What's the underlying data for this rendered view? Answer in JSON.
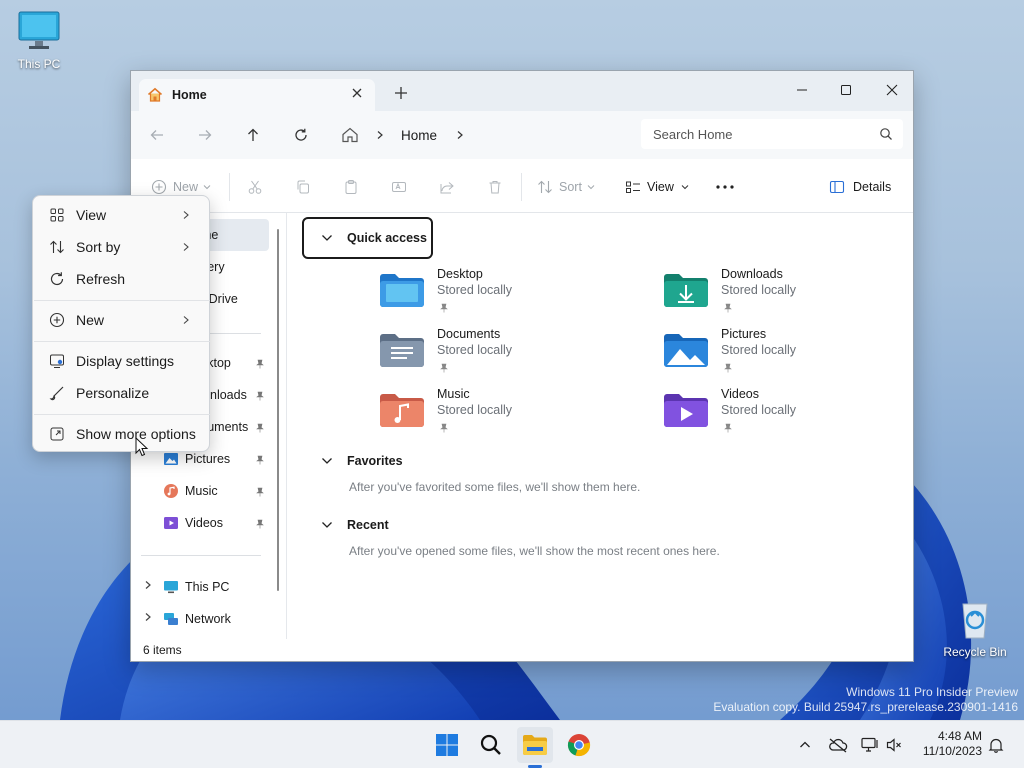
{
  "desktop": {
    "this_pc_label": "This PC",
    "recycle_bin_label": "Recycle Bin",
    "watermark_line1": "Windows 11 Pro Insider Preview",
    "watermark_line2": "Evaluation copy. Build 25947.rs_prerelease.230901-1416"
  },
  "window": {
    "tab_title": "Home",
    "breadcrumb": "Home",
    "search_placeholder": "Search Home",
    "status": "6 items"
  },
  "toolbar": {
    "new_label": "New",
    "sort_label": "Sort",
    "view_label": "View",
    "details_label": "Details"
  },
  "sidebar": {
    "items": [
      {
        "label": "Home"
      },
      {
        "label": "Gallery"
      },
      {
        "label": "OneDrive"
      },
      {
        "label": "Desktop"
      },
      {
        "label": "Downloads"
      },
      {
        "label": "Documents"
      },
      {
        "label": "Pictures"
      },
      {
        "label": "Music"
      },
      {
        "label": "Videos"
      },
      {
        "label": "This PC"
      },
      {
        "label": "Network"
      }
    ]
  },
  "content": {
    "quick_access": "Quick access",
    "favorites": "Favorites",
    "favorites_msg": "After you've favorited some files, we'll show them here.",
    "recent": "Recent",
    "recent_msg": "After you've opened some files, we'll show the most recent ones here.",
    "folders": [
      {
        "name": "Desktop",
        "sub": "Stored locally",
        "icon": "desktop-folder-icon"
      },
      {
        "name": "Downloads",
        "sub": "Stored locally",
        "icon": "downloads-folder-icon"
      },
      {
        "name": "Documents",
        "sub": "Stored locally",
        "icon": "documents-folder-icon"
      },
      {
        "name": "Pictures",
        "sub": "Stored locally",
        "icon": "pictures-folder-icon"
      },
      {
        "name": "Music",
        "sub": "Stored locally",
        "icon": "music-folder-icon"
      },
      {
        "name": "Videos",
        "sub": "Stored locally",
        "icon": "videos-folder-icon"
      }
    ]
  },
  "context_menu": {
    "items": [
      {
        "label": "View"
      },
      {
        "label": "Sort by"
      },
      {
        "label": "Refresh"
      },
      {
        "label": "New"
      },
      {
        "label": "Display settings"
      },
      {
        "label": "Personalize"
      },
      {
        "label": "Show more options"
      }
    ]
  },
  "taskbar": {
    "time": "4:48 AM",
    "date": "11/10/2023"
  },
  "colors": {
    "accent": "#2a6fd6",
    "folder_blue": "#3d8ee0",
    "folder_teal": "#1fa68f",
    "folder_gray": "#7f8fa3",
    "folder_orange": "#e5775a",
    "folder_purple": "#7d4fd6"
  }
}
